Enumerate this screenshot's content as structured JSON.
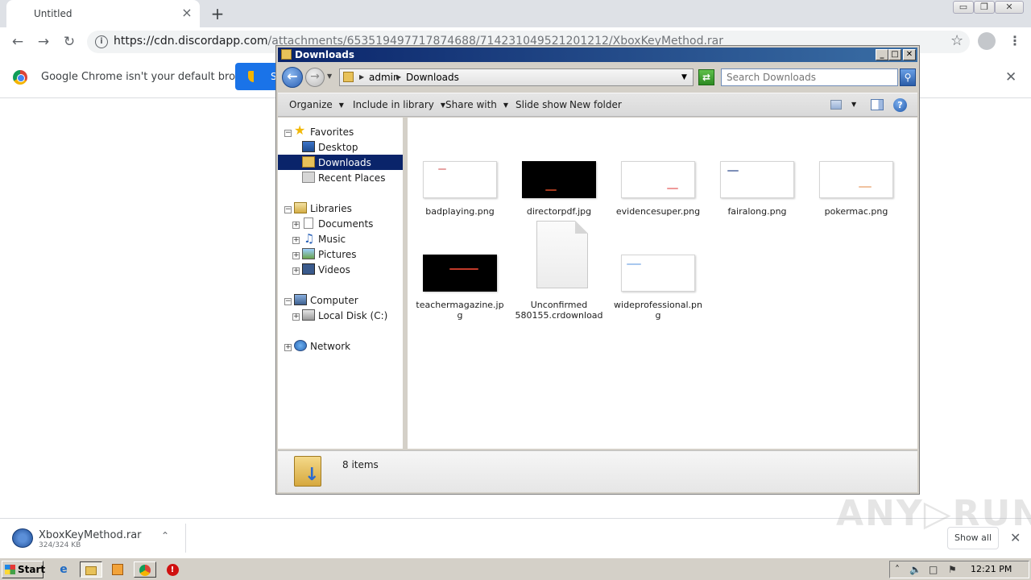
{
  "browser": {
    "tab_title": "Untitled",
    "tab_close": "×",
    "new_tab": "+",
    "window_buttons": [
      "▭",
      "❐",
      "✕"
    ],
    "url_domain": "https://cdn.discordapp.com",
    "url_path": "/attachments/653519497717874688/714231049521201212/XboxKeyMethod.rar",
    "default_browser_text": "Google Chrome isn't your default browser",
    "set_default_label": "S",
    "infobar_close": "✕"
  },
  "explorer": {
    "title": "Downloads",
    "title_buttons": [
      "_",
      "□",
      "✕"
    ],
    "breadcrumb": [
      "admin",
      "Downloads"
    ],
    "search_placeholder": "Search Downloads",
    "toolbar": {
      "organize": "Organize",
      "include_in_library": "Include in library",
      "share_with": "Share with",
      "slide_show": "Slide show",
      "new_folder": "New folder",
      "help": "?"
    },
    "nav": {
      "favorites": "Favorites",
      "desktop": "Desktop",
      "downloads": "Downloads",
      "recent_places": "Recent Places",
      "libraries": "Libraries",
      "documents": "Documents",
      "music": "Music",
      "pictures": "Pictures",
      "videos": "Videos",
      "computer": "Computer",
      "local_disk": "Local Disk (C:)",
      "network": "Network"
    },
    "files": [
      {
        "name": "badplaying.png"
      },
      {
        "name": "directorpdf.jpg"
      },
      {
        "name": "evidencesuper.png"
      },
      {
        "name": "fairalong.png"
      },
      {
        "name": "pokermac.png"
      },
      {
        "name": "teachermagazine.jpg"
      },
      {
        "name": "Unconfirmed 580155.crdownload"
      },
      {
        "name": "wideprofessional.png"
      }
    ],
    "status": "8 items"
  },
  "downloads": {
    "file_name": "XboxKeyMethod.rar",
    "file_size": "324/324 KB",
    "show_all": "Show all",
    "close": "✕"
  },
  "watermark": "ANY▷RUN",
  "taskbar": {
    "start": "Start",
    "clock": "12:21 PM"
  }
}
